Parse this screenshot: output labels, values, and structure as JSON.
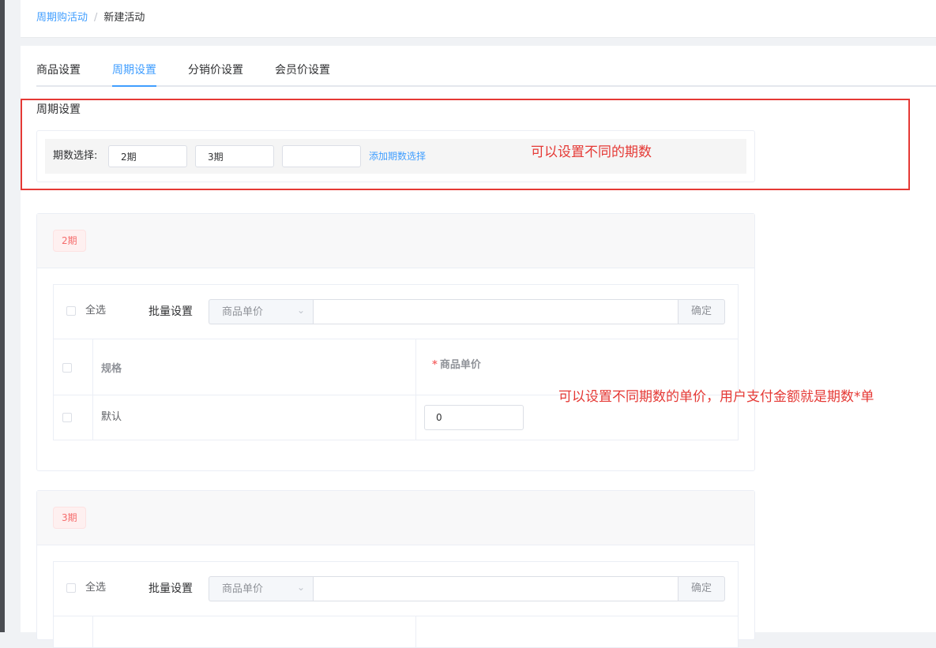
{
  "breadcrumb": {
    "parent": "周期购活动",
    "separator": "/",
    "current": "新建活动"
  },
  "tabs": [
    {
      "label": "商品设置",
      "active": false
    },
    {
      "label": "周期设置",
      "active": true
    },
    {
      "label": "分销价设置",
      "active": false
    },
    {
      "label": "会员价设置",
      "active": false
    }
  ],
  "period_settings": {
    "title": "周期设置",
    "label": "期数选择:",
    "inputs": [
      "2期",
      "3期",
      ""
    ],
    "add_link": "添加期数选择"
  },
  "annotations": {
    "first": "可以设置不同的期数",
    "second": "可以设置不同期数的单价，用户支付金额就是期数*单"
  },
  "period_blocks": [
    {
      "tag": "2期",
      "select_all": "全选",
      "batch_label": "批量设置",
      "batch_select": "商品单价",
      "batch_input": "",
      "confirm": "确定",
      "col_spec": "规格",
      "col_price": "商品单价",
      "row_spec": "默认",
      "row_price": "0"
    },
    {
      "tag": "3期",
      "select_all": "全选",
      "batch_label": "批量设置",
      "batch_select": "商品单价",
      "batch_input": "",
      "confirm": "确定"
    }
  ],
  "colors": {
    "primary": "#409eff",
    "annotation": "#e53935",
    "tag": "#f56c6c"
  }
}
